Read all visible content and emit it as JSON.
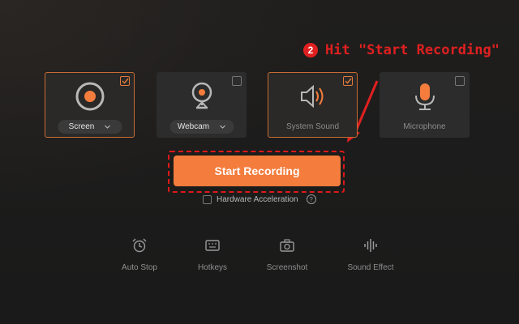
{
  "annotation": {
    "step": "2",
    "text": "Hit \"Start Recording\""
  },
  "cards": [
    {
      "id": "screen",
      "label": "Screen",
      "selected": true,
      "has_dropdown": true
    },
    {
      "id": "webcam",
      "label": "Webcam",
      "selected": false,
      "has_dropdown": true
    },
    {
      "id": "system-sound",
      "label": "System Sound",
      "selected": true,
      "has_dropdown": false
    },
    {
      "id": "microphone",
      "label": "Microphone",
      "selected": false,
      "has_dropdown": false
    }
  ],
  "start_button": {
    "label": "Start Recording"
  },
  "hardware_acceleration": {
    "label": "Hardware Acceleration",
    "checked": false
  },
  "tools": [
    {
      "id": "auto-stop",
      "label": "Auto Stop",
      "icon": "alarm-clock-icon"
    },
    {
      "id": "hotkeys",
      "label": "Hotkeys",
      "icon": "keyboard-icon"
    },
    {
      "id": "screenshot",
      "label": "Screenshot",
      "icon": "camera-icon"
    },
    {
      "id": "sound-effect",
      "label": "Sound Effect",
      "icon": "sound-wave-icon"
    }
  ],
  "colors": {
    "accent": "#f47c3c",
    "annotation_red": "#e02020",
    "background": "#1c1c1c",
    "card": "#2c2c2c"
  }
}
